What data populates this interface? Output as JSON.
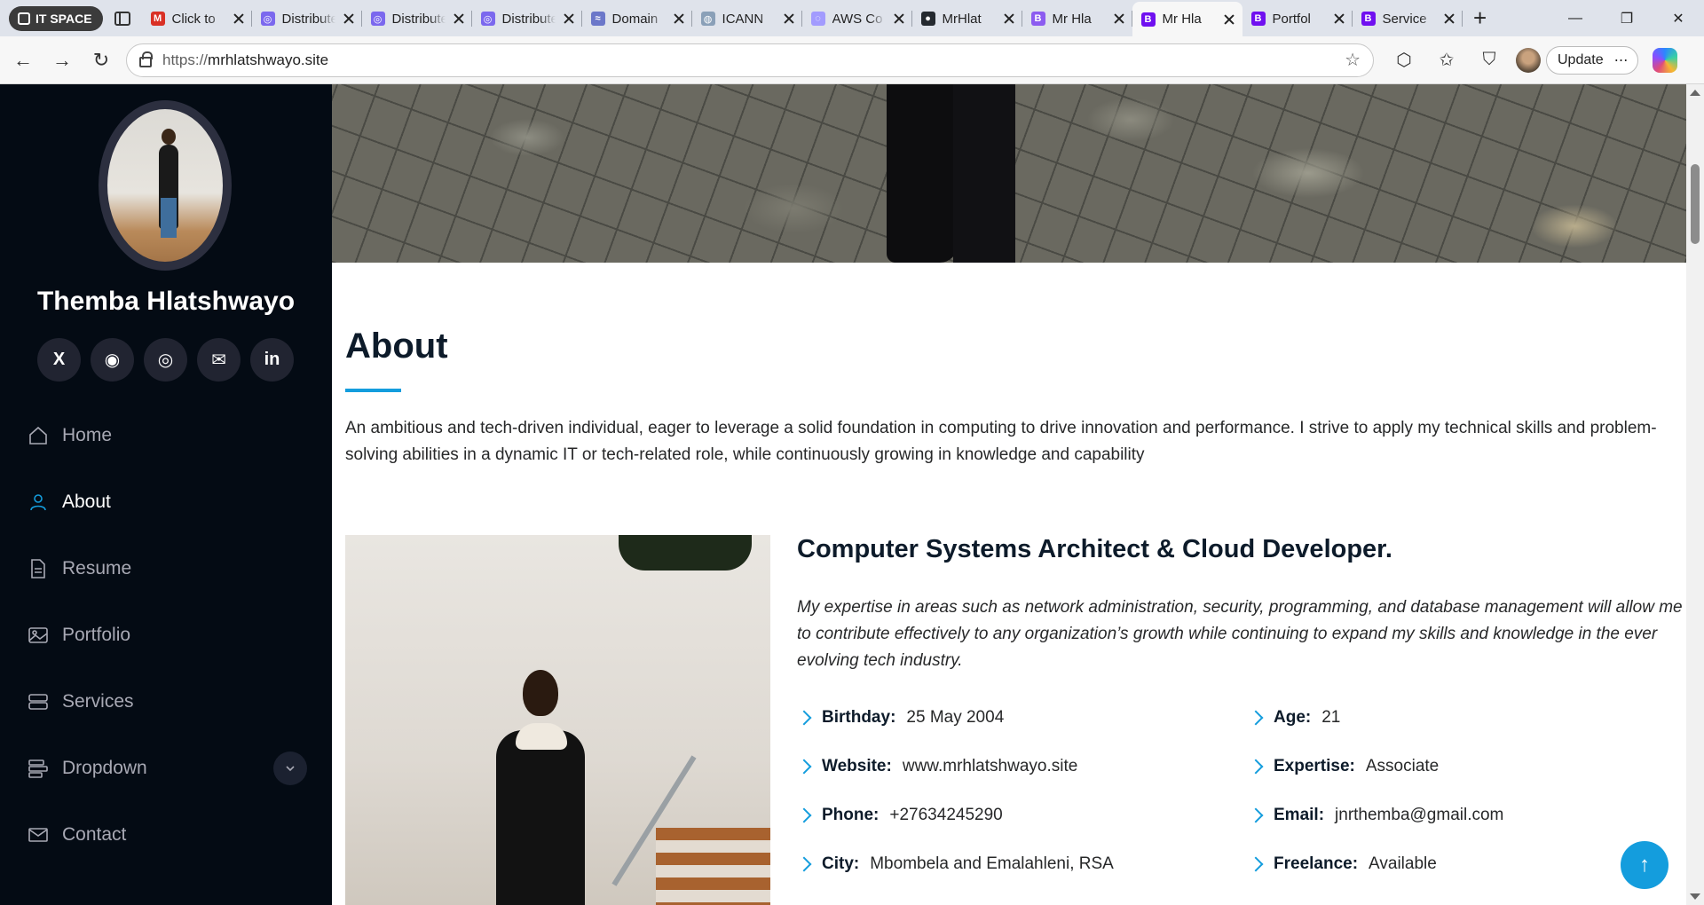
{
  "browser": {
    "profile_label": "IT SPACE",
    "tabs": [
      {
        "title": "Click to",
        "favicon": "gmail-icon",
        "color": "#d93025",
        "glyph": "M",
        "active": false
      },
      {
        "title": "Distributed",
        "favicon": "app-icon",
        "color": "#7b68ee",
        "glyph": "◎",
        "active": false
      },
      {
        "title": "Distributed",
        "favicon": "app-icon",
        "color": "#7b68ee",
        "glyph": "◎",
        "active": false
      },
      {
        "title": "Distributed",
        "favicon": "app-icon",
        "color": "#7b68ee",
        "glyph": "◎",
        "active": false
      },
      {
        "title": "Domain",
        "favicon": "domain-icon",
        "color": "#6b77c9",
        "glyph": "≈",
        "active": false
      },
      {
        "title": "ICANN",
        "favicon": "globe-icon",
        "color": "#8aa0b8",
        "glyph": "◍",
        "active": false
      },
      {
        "title": "AWS Co",
        "favicon": "aws-icon",
        "color": "#a29bfe",
        "glyph": "◌",
        "active": false
      },
      {
        "title": "MrHlat",
        "favicon": "github-icon",
        "color": "#24292f",
        "glyph": "●",
        "active": false
      },
      {
        "title": "Mr Hla",
        "favicon": "bootstrap-icon",
        "color": "#8c5cf0",
        "glyph": "B",
        "active": false
      },
      {
        "title": "Mr Hla",
        "favicon": "bootstrap-icon",
        "color": "#7010f0",
        "glyph": "B",
        "active": true
      },
      {
        "title": "Portfol",
        "favicon": "bootstrap-icon",
        "color": "#7010f0",
        "glyph": "B",
        "active": false
      },
      {
        "title": "Service",
        "favicon": "bootstrap-icon",
        "color": "#7010f0",
        "glyph": "B",
        "active": false
      }
    ],
    "url_scheme": "https://",
    "url_host": "mrhlatshwayo.site",
    "update_label": "Update"
  },
  "sidebar": {
    "name": "Themba Hlatshwayo",
    "socials": [
      {
        "icon": "x-icon",
        "glyph": "X"
      },
      {
        "icon": "github-icon",
        "glyph": "◉"
      },
      {
        "icon": "instagram-icon",
        "glyph": "◎"
      },
      {
        "icon": "mail-icon",
        "glyph": "✉"
      },
      {
        "icon": "linkedin-icon",
        "glyph": "in"
      }
    ],
    "nav": [
      {
        "label": "Home",
        "icon": "house-icon",
        "active": false
      },
      {
        "label": "About",
        "icon": "person-icon",
        "active": true
      },
      {
        "label": "Resume",
        "icon": "file-icon",
        "active": false
      },
      {
        "label": "Portfolio",
        "icon": "images-icon",
        "active": false
      },
      {
        "label": "Services",
        "icon": "server-icon",
        "active": false
      },
      {
        "label": "Dropdown",
        "icon": "menu-icon",
        "active": false
      },
      {
        "label": "Contact",
        "icon": "envelope-icon",
        "active": false
      }
    ]
  },
  "about": {
    "title": "About",
    "intro": "An ambitious and tech-driven individual, eager to leverage a solid foundation in computing to drive innovation and performance. I strive to apply my technical skills and problem-solving abilities in a dynamic IT or tech-related role, while continuously growing in knowledge and capability",
    "role": "Computer Systems Architect & Cloud Developer.",
    "lead": "My expertise in areas such as network administration, security, programming, and database management will allow me to contribute effectively to any organization’s growth while continuing to expand my skills and knowledge in the ever evolving tech industry.",
    "facts": [
      {
        "label": "Birthday:",
        "value": "25 May 2004"
      },
      {
        "label": "Age:",
        "value": "21"
      },
      {
        "label": "Website:",
        "value": "www.mrhlatshwayo.site"
      },
      {
        "label": "Expertise:",
        "value": "Associate"
      },
      {
        "label": "Phone:",
        "value": "+27634245290"
      },
      {
        "label": "Email:",
        "value": "jnrthemba@gmail.com"
      },
      {
        "label": "City:",
        "value": "Mbombela and Emalahleni, RSA"
      },
      {
        "label": "Freelance:",
        "value": "Available"
      }
    ]
  },
  "colors": {
    "accent": "#149ddd",
    "sidebar_bg": "#040b14"
  }
}
